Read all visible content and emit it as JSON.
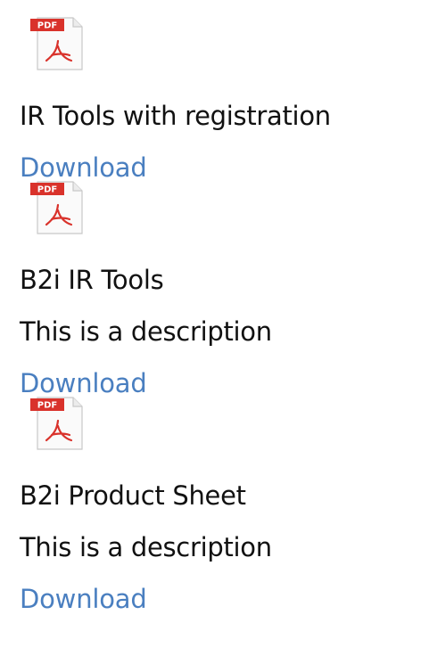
{
  "documents": [
    {
      "icon": "pdf-file-icon",
      "icon_badge": "PDF",
      "title": "IR Tools with registration",
      "description": "",
      "link_label": "Download"
    },
    {
      "icon": "pdf-file-icon",
      "icon_badge": "PDF",
      "title": "B2i IR Tools",
      "description": "This is a description",
      "link_label": "Download"
    },
    {
      "icon": "pdf-file-icon",
      "icon_badge": "PDF",
      "title": "B2i Product Sheet",
      "description": "This is a description",
      "link_label": "Download"
    }
  ],
  "colors": {
    "link": "#4a7fc0",
    "text": "#111111",
    "pdf_badge": "#d9322b"
  }
}
